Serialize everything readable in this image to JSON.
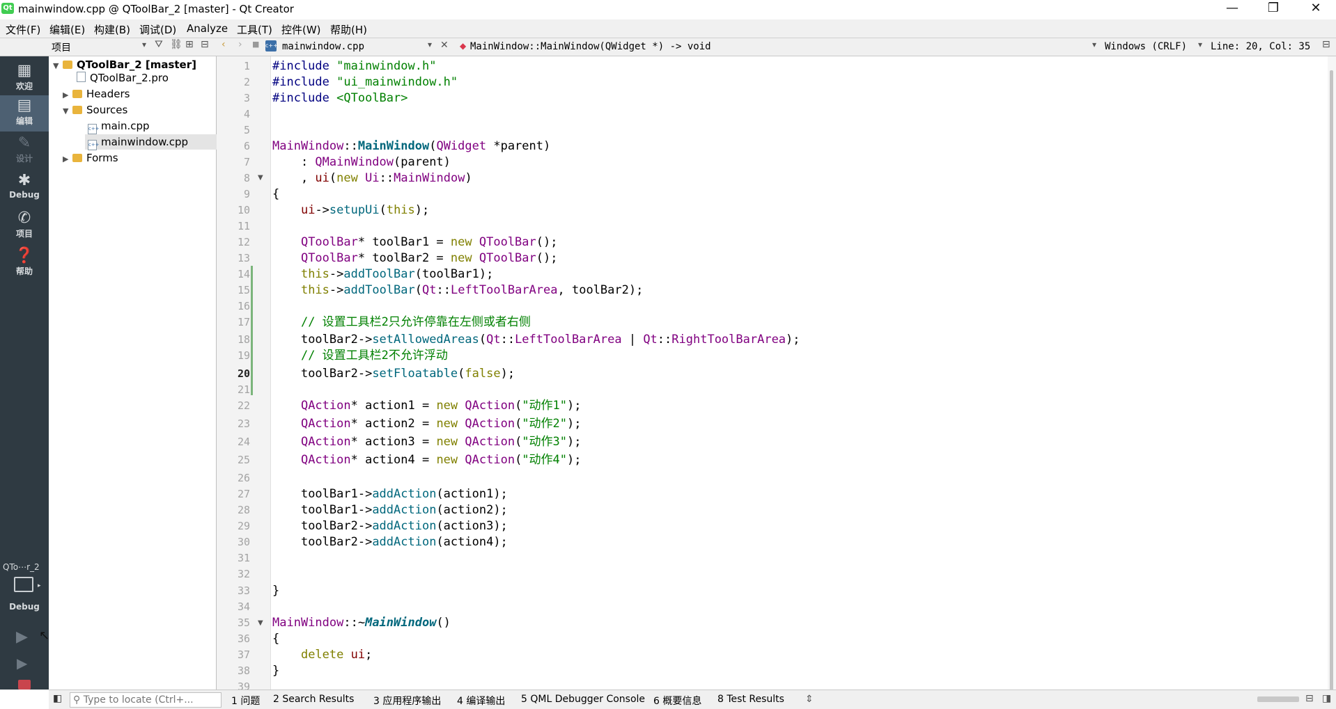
{
  "window": {
    "title": "mainwindow.cpp @ QToolBar_2 [master] - Qt Creator",
    "app_icon": "Qt"
  },
  "menu": [
    "文件(F)",
    "编辑(E)",
    "构建(B)",
    "调试(D)",
    "Analyze",
    "工具(T)",
    "控件(W)",
    "帮助(H)"
  ],
  "project_pane": {
    "title": "项目"
  },
  "editor_bar": {
    "file": "mainwindow.cpp",
    "symbol": "MainWindow::MainWindow(QWidget *) -> void",
    "encoding": "Windows (CRLF)",
    "position": "Line: 20, Col: 35"
  },
  "modes": {
    "welcome": "欢迎",
    "edit": "编辑",
    "design": "设计",
    "debug": "Debug",
    "projects": "项目",
    "help": "帮助"
  },
  "kit": {
    "project": "QTo⋯r_2",
    "config": "Debug"
  },
  "tree": {
    "root": "QToolBar_2 [master]",
    "pro": "QToolBar_2.pro",
    "headers": "Headers",
    "sources": "Sources",
    "main": "main.cpp",
    "mainwindow": "mainwindow.cpp",
    "forms": "Forms"
  },
  "code": {
    "line_numbers": [
      "1",
      "2",
      "3",
      "4",
      "5",
      "6",
      "7",
      "8",
      "9",
      "10",
      "11",
      "12",
      "13",
      "14",
      "15",
      "16",
      "17",
      "18",
      "19",
      "20",
      "21",
      "22",
      "23",
      "24",
      "25",
      "26",
      "27",
      "28",
      "29",
      "30",
      "31",
      "32",
      "33",
      "34",
      "35",
      "36",
      "37",
      "38",
      "39"
    ],
    "current_line": "20",
    "l1_kw": "#include",
    "l1_s": "\"mainwindow.h\"",
    "l2_kw": "#include",
    "l2_s": "\"ui_mainwindow.h\"",
    "l3_kw": "#include",
    "l3_s": "<QToolBar>",
    "l6_cls": "MainWindow",
    "l6_op": "::",
    "l6_fn": "MainWindow",
    "l6_p1": "(",
    "l6_ty": "QWidget",
    "l6_p2": " *parent)",
    "l7_a": "    : ",
    "l7_ty": "QMainWindow",
    "l7_b": "(parent)",
    "l8_a": "    , ",
    "l8_m": "ui",
    "l8_b": "(",
    "l8_kw": "new",
    "l8_c": " ",
    "l8_ns": "Ui",
    "l8_d": "::",
    "l8_ty": "MainWindow",
    "l8_e": ")",
    "l9": "{",
    "l10_m": "ui",
    "l10_a": "->",
    "l10_fn": "setupUi",
    "l10_b": "(",
    "l10_kw": "this",
    "l10_c": ");",
    "l12_ty": "QToolBar",
    "l12_a": "* toolBar1 = ",
    "l12_kw": "new",
    "l12_b": " ",
    "l12_ty2": "QToolBar",
    "l12_c": "();",
    "l13_ty": "QToolBar",
    "l13_a": "* toolBar2 = ",
    "l13_kw": "new",
    "l13_b": " ",
    "l13_ty2": "QToolBar",
    "l13_c": "();",
    "l14_kw": "this",
    "l14_a": "->",
    "l14_fn": "addToolBar",
    "l14_b": "(toolBar1);",
    "l15_kw": "this",
    "l15_a": "->",
    "l15_fn": "addToolBar",
    "l15_b": "(",
    "l15_ns": "Qt",
    "l15_c": "::",
    "l15_en": "LeftToolBarArea",
    "l15_d": ", toolBar2);",
    "l17_cmt": "// 设置工具栏2只允许停靠在左侧或者右侧",
    "l18_a": "toolBar2->",
    "l18_fn": "setAllowedAreas",
    "l18_b": "(",
    "l18_ns": "Qt",
    "l18_c": "::",
    "l18_en": "LeftToolBarArea",
    "l18_d": " | ",
    "l18_ns2": "Qt",
    "l18_e": "::",
    "l18_en2": "RightToolBarArea",
    "l18_f": ");",
    "l19_cmt": "// 设置工具栏2不允许浮动",
    "l20_a": "toolBar2->",
    "l20_fn": "setFloatable",
    "l20_b": "(",
    "l20_kw": "false",
    "l20_c": ");",
    "l22_ty": "QAction",
    "l22_a": "* action1 = ",
    "l22_kw": "new",
    "l22_b": " ",
    "l22_ty2": "QAction",
    "l22_c": "(",
    "l22_s": "\"动作1\"",
    "l22_d": ");",
    "l23_ty": "QAction",
    "l23_a": "* action2 = ",
    "l23_kw": "new",
    "l23_b": " ",
    "l23_ty2": "QAction",
    "l23_c": "(",
    "l23_s": "\"动作2\"",
    "l23_d": ");",
    "l24_ty": "QAction",
    "l24_a": "* action3 = ",
    "l24_kw": "new",
    "l24_b": " ",
    "l24_ty2": "QAction",
    "l24_c": "(",
    "l24_s": "\"动作3\"",
    "l24_d": ");",
    "l25_ty": "QAction",
    "l25_a": "* action4 = ",
    "l25_kw": "new",
    "l25_b": " ",
    "l25_ty2": "QAction",
    "l25_c": "(",
    "l25_s": "\"动作4\"",
    "l25_d": ");",
    "l27_a": "toolBar1->",
    "l27_fn": "addAction",
    "l27_b": "(action1);",
    "l28_a": "toolBar1->",
    "l28_fn": "addAction",
    "l28_b": "(action2);",
    "l29_a": "toolBar2->",
    "l29_fn": "addAction",
    "l29_b": "(action3);",
    "l30_a": "toolBar2->",
    "l30_fn": "addAction",
    "l30_b": "(action4);",
    "l33": "}",
    "l35_cls": "MainWindow",
    "l35_op": "::~",
    "l35_fn": "MainWindow",
    "l35_p": "()",
    "l36": "{",
    "l37_kw": "delete",
    "l37_m": "ui",
    "l37_a": ";",
    "l38": "}"
  },
  "bottom": {
    "locate_placeholder": "Type to locate (Ctrl+...",
    "tabs": [
      "1 问题",
      "2 Search Results",
      "3 应用程序输出",
      "4 编译输出",
      "5 QML Debugger Console",
      "6 概要信息",
      "8 Test Results"
    ]
  },
  "colors": {
    "sidebar": "#2f3a42",
    "sidebar_active": "#4d6072",
    "keyword": "#808000",
    "type": "#800080",
    "string": "#008000",
    "function": "#00677c"
  }
}
